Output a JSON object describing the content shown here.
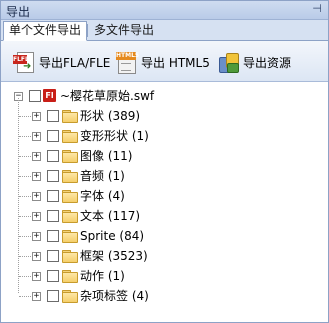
{
  "panel": {
    "title": "导出",
    "pin_icon": "pin-icon"
  },
  "tabs": [
    {
      "label": "单个文件导出",
      "active": true
    },
    {
      "label": "多文件导出",
      "active": false
    }
  ],
  "toolbar": {
    "export_fla_label": "导出FLA/FLE",
    "export_html_label": "导出 HTML5",
    "export_resources_label": "导出资源",
    "fla_icon_text": "FLFL",
    "html_icon_text": "HTML5"
  },
  "tree": {
    "root": {
      "label": "~樱花草原始.swf",
      "icon_text": "Fl",
      "expanded": true
    },
    "items": [
      {
        "label": "形状 (389)"
      },
      {
        "label": "变形形状 (1)"
      },
      {
        "label": "图像 (11)"
      },
      {
        "label": "音频 (1)"
      },
      {
        "label": "字体 (4)"
      },
      {
        "label": "文本 (117)"
      },
      {
        "label": "Sprite (84)"
      },
      {
        "label": "框架 (3523)"
      },
      {
        "label": "动作 (1)"
      },
      {
        "label": "杂项标签 (4)"
      }
    ]
  },
  "colors": {
    "accent": "#8da2c6",
    "flash_red": "#c81e17",
    "folder_yellow": "#f5cf6b"
  }
}
